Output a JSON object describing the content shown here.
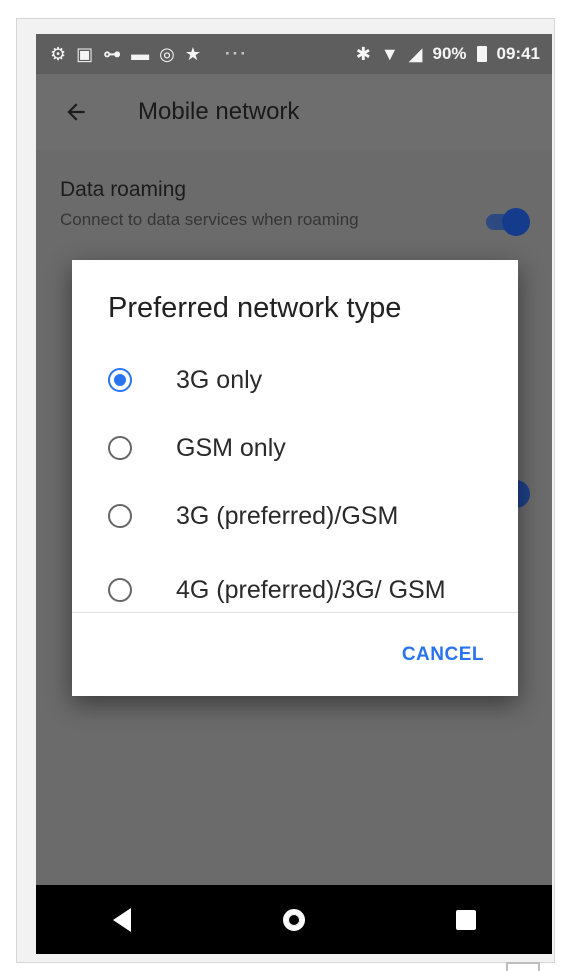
{
  "status_bar": {
    "battery": "90%",
    "time": "09:41",
    "left_icons": [
      "settings-gear-icon",
      "wechat-icon",
      "tacho-icon",
      "folder-icon",
      "at-icon",
      "star-icon"
    ],
    "right_icons": [
      "bluetooth-icon",
      "data-arrows-icon",
      "wifi-icon",
      "signal-icon",
      "battery-icon"
    ]
  },
  "toolbar": {
    "title": "Mobile network",
    "back_icon": "arrow-left-icon"
  },
  "settings": {
    "data_roaming": {
      "title": "Data roaming",
      "summary": "Connect to data services when roaming"
    }
  },
  "dialog": {
    "title": "Preferred network type",
    "options": [
      {
        "label": "3G only",
        "checked": true
      },
      {
        "label": "GSM only",
        "checked": false
      },
      {
        "label": "3G (preferred)/GSM",
        "checked": false
      },
      {
        "label": "4G (preferred)/3G/ GSM",
        "checked": false
      }
    ],
    "cancel_label": "CANCEL"
  },
  "nav_bar": {
    "icons": [
      "back-triangle-icon",
      "home-circle-icon",
      "recents-square-icon"
    ]
  },
  "colors": {
    "accent": "#2b74ef",
    "toolbar": "#6e6e6e",
    "scrim_content": "#6b6b6b",
    "nav_bar": "#000000"
  }
}
